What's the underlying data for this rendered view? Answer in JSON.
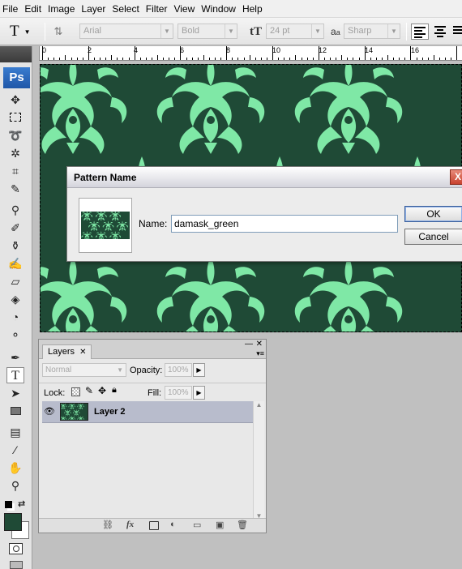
{
  "menu": [
    "File",
    "Edit",
    "Image",
    "Layer",
    "Select",
    "Filter",
    "View",
    "Window",
    "Help"
  ],
  "options": {
    "tool_glyph": "T",
    "font_family": "Arial",
    "font_style": "Bold",
    "font_size": "24 pt",
    "aa_label": "a",
    "aa_mode": "Sharp"
  },
  "ruler": [
    "0",
    "2",
    "4",
    "6",
    "8",
    "10",
    "12",
    "14",
    "16"
  ],
  "toolbox": {
    "logo": "Ps"
  },
  "dialog": {
    "title": "Pattern Name",
    "name_label": "Name:",
    "name_value": "damask_green",
    "ok": "OK",
    "cancel": "Cancel",
    "close": "X"
  },
  "layers": {
    "tab": "Layers",
    "blend": "Normal",
    "opacity_label": "Opacity:",
    "opacity": "100%",
    "lock_label": "Lock:",
    "fill_label": "Fill:",
    "fill": "100%",
    "layer_name": "Layer 2"
  },
  "colors": {
    "fg": "#1f4a36",
    "bg": "#ffffff",
    "pattern_dark": "#1f4a36",
    "pattern_light": "#7fe8a6"
  }
}
